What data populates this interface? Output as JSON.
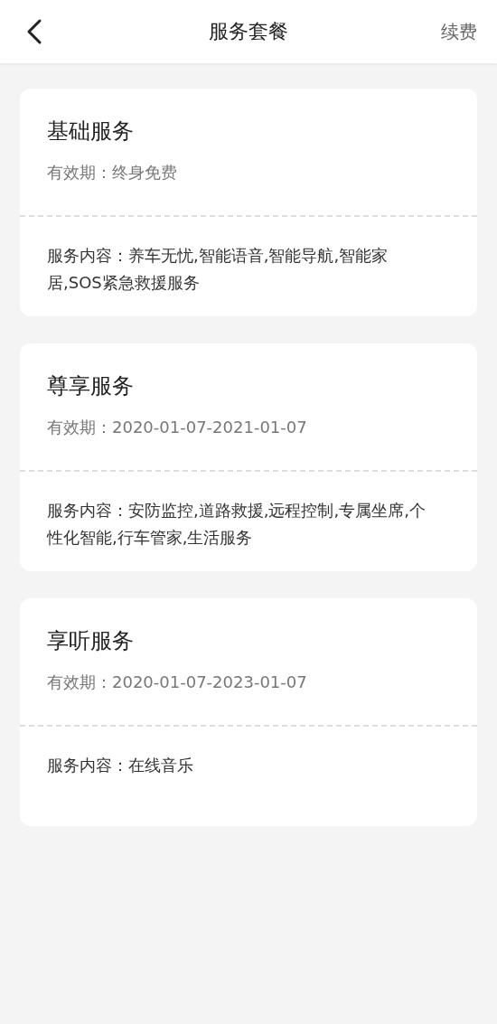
{
  "header": {
    "title": "服务套餐",
    "action": "续费"
  },
  "packages": [
    {
      "name": "基础服务",
      "validity": "有效期：终身免费",
      "content": "服务内容：养车无忧,智能语音,智能导航,智能家居,SOS紧急救援服务"
    },
    {
      "name": "尊享服务",
      "validity": "有效期：2020-01-07-2021-01-07",
      "content": "服务内容：安防监控,道路救援,远程控制,专属坐席,个性化智能,行车管家,生活服务"
    },
    {
      "name": "享听服务",
      "validity": "有效期：2020-01-07-2023-01-07",
      "content": "服务内容：在线音乐"
    }
  ]
}
